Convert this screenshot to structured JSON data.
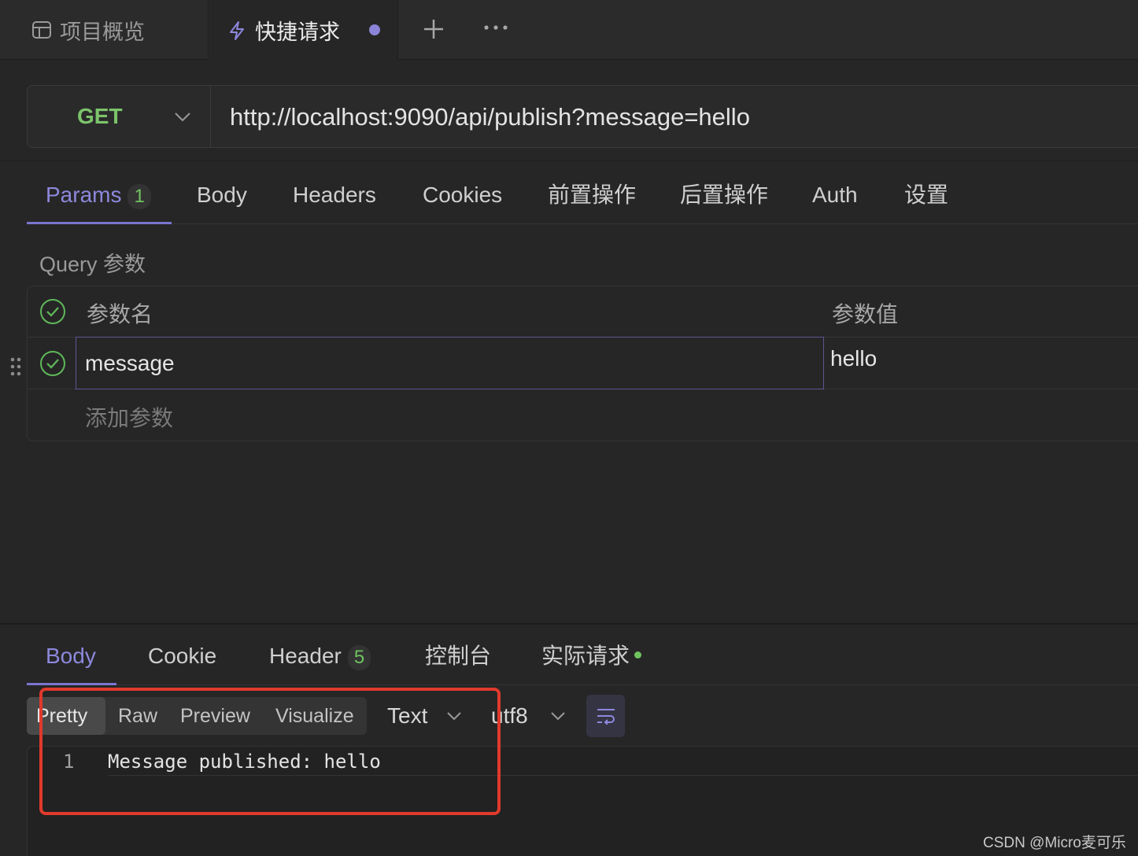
{
  "tabs": {
    "overview_label": "项目概览",
    "quick_label": "快捷请求",
    "quick_unsaved": true,
    "plus_label": "+",
    "more_label": "···"
  },
  "request": {
    "method": "GET",
    "url": "http://localhost:9090/api/publish?message=hello"
  },
  "request_tabs": {
    "params": "Params",
    "params_count": "1",
    "body": "Body",
    "headers": "Headers",
    "cookies": "Cookies",
    "pre_ops": "前置操作",
    "post_ops": "后置操作",
    "auth": "Auth",
    "settings": "设置",
    "active": "Params"
  },
  "params": {
    "section_label": "Query 参数",
    "col_name": "参数名",
    "col_value": "参数值",
    "rows": [
      {
        "enabled": true,
        "name": "message",
        "value": "hello"
      }
    ],
    "add_placeholder": "添加参数"
  },
  "response_tabs": {
    "body": "Body",
    "cookie": "Cookie",
    "header": "Header",
    "header_count": "5",
    "console": "控制台",
    "actual_request": "实际请求",
    "active": "Body"
  },
  "response_view": {
    "modes": [
      "Pretty",
      "Raw",
      "Preview",
      "Visualize"
    ],
    "active_mode": "Pretty",
    "format": "Text",
    "encoding": "utf8"
  },
  "response_body": {
    "line_number": "1",
    "line_text": "Message published: hello"
  },
  "colors": {
    "accent": "#8d88dd",
    "method_get": "#7cc46b",
    "highlight_box": "#e03a2c"
  },
  "watermark": "CSDN @Micro麦可乐"
}
